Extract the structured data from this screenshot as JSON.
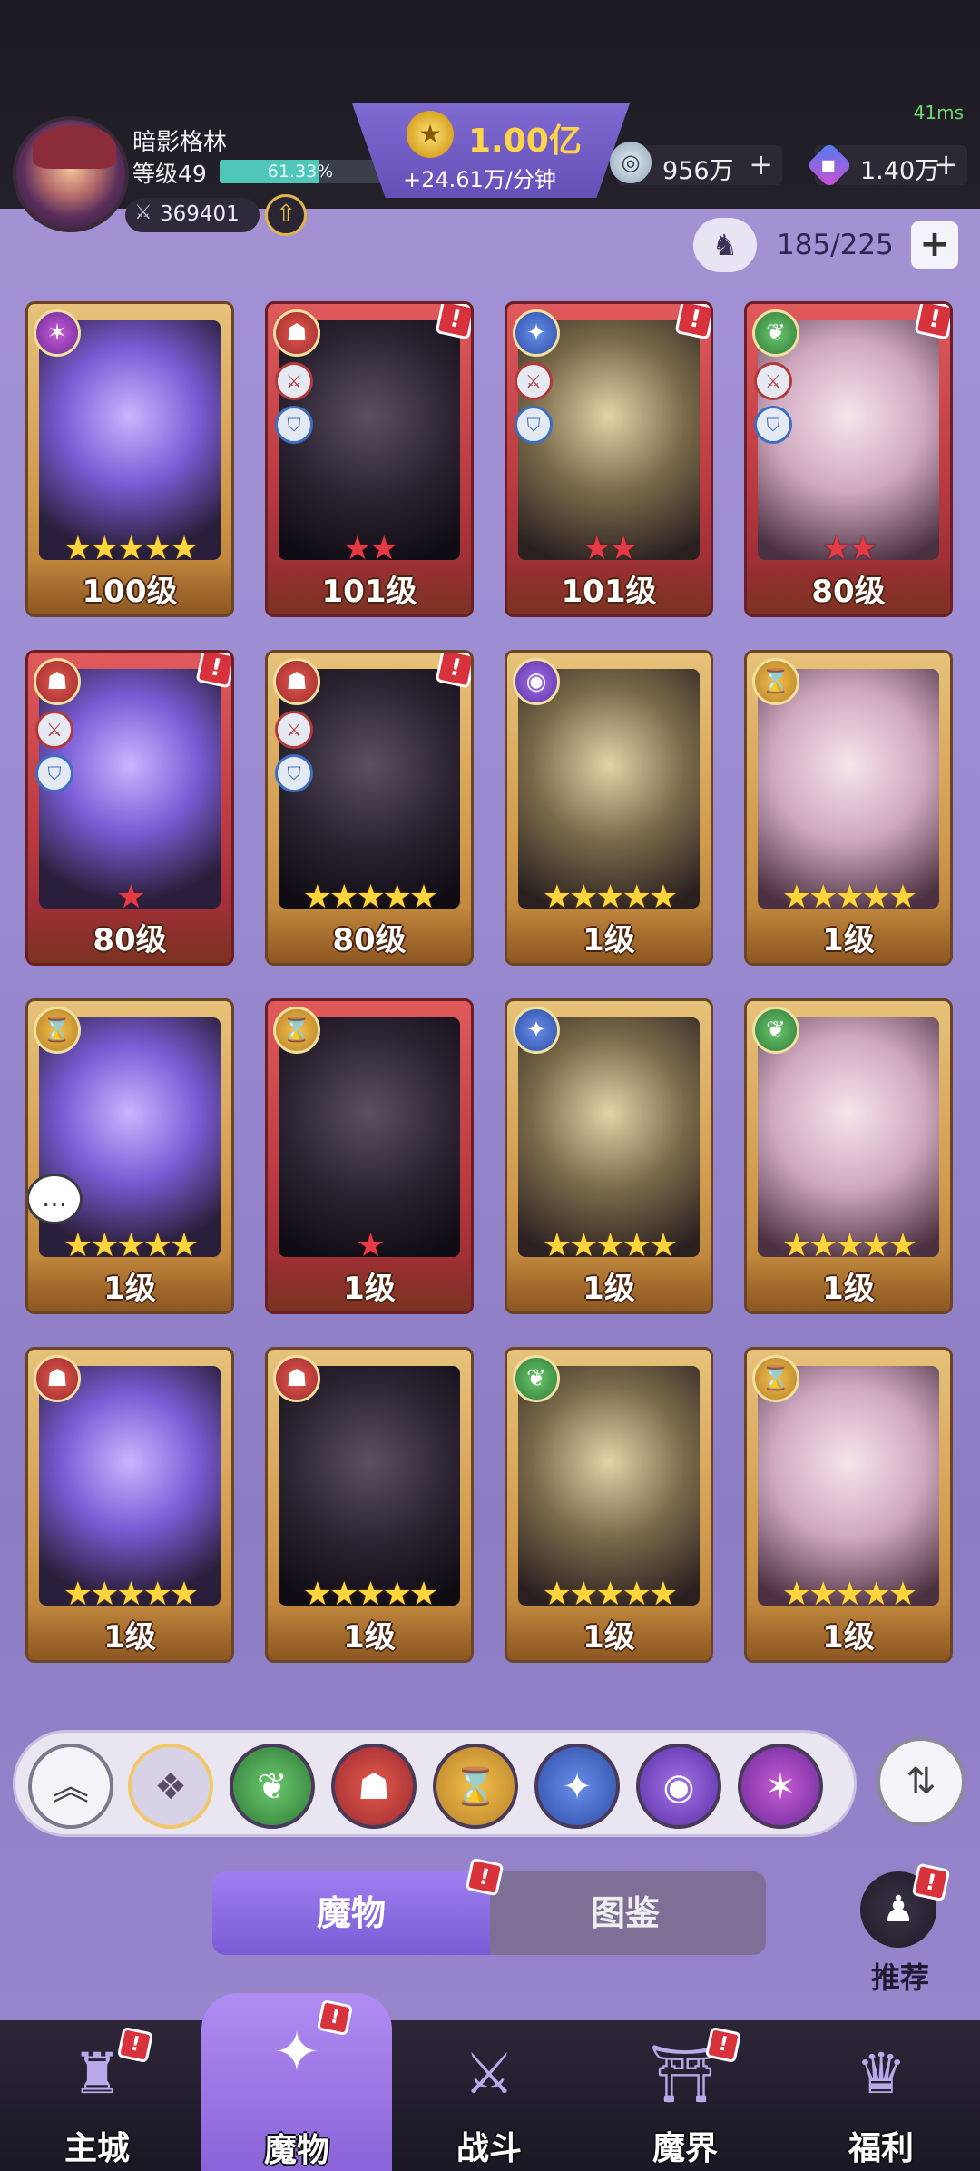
{
  "header": {
    "ping": "41ms",
    "player_name": "暗影格林",
    "level_label": "等级49",
    "exp_percent_text": "61.33%",
    "exp_fraction": 0.6133,
    "power": "369401",
    "gold_amount": "1.00亿",
    "gold_rate": "+24.61万/分钟",
    "resource_silver": "956万",
    "resource_gem": "1.40万",
    "capacity": "185/225"
  },
  "cards": [
    {
      "level": "100级",
      "frame": "gold",
      "faction": "violet",
      "stars": 5,
      "star_color": "yellow",
      "roles": false,
      "alert": false
    },
    {
      "level": "101级",
      "frame": "red",
      "faction": "red",
      "stars": 2,
      "star_color": "red",
      "roles": true,
      "alert": true
    },
    {
      "level": "101级",
      "frame": "red",
      "faction": "blue",
      "stars": 2,
      "star_color": "red",
      "roles": true,
      "alert": true
    },
    {
      "level": "80级",
      "frame": "red",
      "faction": "green",
      "stars": 2,
      "star_color": "red",
      "roles": true,
      "alert": true
    },
    {
      "level": "80级",
      "frame": "red",
      "faction": "red",
      "stars": 1,
      "star_color": "red",
      "roles": true,
      "alert": true
    },
    {
      "level": "80级",
      "frame": "gold",
      "faction": "red",
      "stars": 5,
      "star_color": "yellow",
      "roles": true,
      "alert": true
    },
    {
      "level": "1级",
      "frame": "gold",
      "faction": "purple",
      "stars": 5,
      "star_color": "yellow",
      "roles": false,
      "alert": false
    },
    {
      "level": "1级",
      "frame": "gold",
      "faction": "gold",
      "stars": 5,
      "star_color": "yellow",
      "roles": false,
      "alert": false
    },
    {
      "level": "1级",
      "frame": "gold",
      "faction": "gold",
      "stars": 5,
      "star_color": "yellow",
      "roles": false,
      "alert": false,
      "chat": true
    },
    {
      "level": "1级",
      "frame": "red",
      "faction": "gold",
      "stars": 1,
      "star_color": "red",
      "roles": false,
      "alert": false
    },
    {
      "level": "1级",
      "frame": "gold",
      "faction": "blue",
      "stars": 5,
      "star_color": "yellow",
      "roles": false,
      "alert": false
    },
    {
      "level": "1级",
      "frame": "gold",
      "faction": "green",
      "stars": 5,
      "star_color": "yellow",
      "roles": false,
      "alert": false
    },
    {
      "level": "1级",
      "frame": "gold",
      "faction": "red",
      "stars": 5,
      "star_color": "yellow",
      "roles": false,
      "alert": false
    },
    {
      "level": "1级",
      "frame": "gold",
      "faction": "red",
      "stars": 5,
      "star_color": "yellow",
      "roles": false,
      "alert": false
    },
    {
      "level": "1级",
      "frame": "gold",
      "faction": "green",
      "stars": 5,
      "star_color": "yellow",
      "roles": false,
      "alert": false
    },
    {
      "level": "1级",
      "frame": "gold",
      "faction": "gold",
      "stars": 5,
      "star_color": "yellow",
      "roles": false,
      "alert": false
    }
  ],
  "filters": [
    {
      "name": "collapse-filter",
      "icon": "chevron-up-icon",
      "glyph": "︽"
    },
    {
      "name": "all-filter",
      "icon": "diamond-grid-icon",
      "glyph": "❖"
    },
    {
      "name": "nature-filter",
      "icon": "leaf-icon",
      "glyph": "❦",
      "color": "green"
    },
    {
      "name": "demon-filter",
      "icon": "mask-icon",
      "glyph": "☗",
      "color": "red"
    },
    {
      "name": "time-filter",
      "icon": "hourglass-icon",
      "glyph": "⌛",
      "color": "gold"
    },
    {
      "name": "beast-filter",
      "icon": "wolf-icon",
      "glyph": "✦",
      "color": "blue"
    },
    {
      "name": "eye-filter",
      "icon": "eye-icon",
      "glyph": "◉",
      "color": "purple"
    },
    {
      "name": "arcane-filter",
      "icon": "star-swirl-icon",
      "glyph": "✶",
      "color": "violet"
    }
  ],
  "tabs": {
    "monster": "魔物",
    "guide": "图鉴"
  },
  "recommend_label": "推荐",
  "nav": [
    {
      "label": "主城",
      "icon": "castle-icon",
      "glyph": "♜",
      "alert": true
    },
    {
      "label": "魔物",
      "icon": "flame-icon",
      "glyph": "✦",
      "alert": true,
      "active": true
    },
    {
      "label": "战斗",
      "icon": "shield-sword-icon",
      "glyph": "⚔",
      "alert": false
    },
    {
      "label": "魔界",
      "icon": "portal-icon",
      "glyph": "⛩",
      "alert": true
    },
    {
      "label": "福利",
      "icon": "chest-icon",
      "glyph": "♛",
      "alert": false
    }
  ],
  "colors": {
    "accent": "#7a5cd6",
    "alert": "#d8333c",
    "gold_text": "#ffd34a"
  }
}
